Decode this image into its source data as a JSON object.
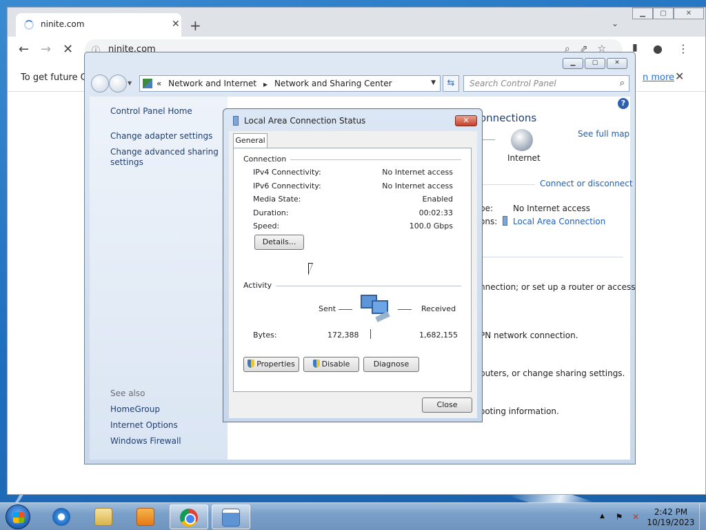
{
  "browser": {
    "tab_title": "ninite.com",
    "url": "ninite.com",
    "infobar_text": "To get future Go",
    "infobar_link": "n more"
  },
  "control_panel": {
    "breadcrumb_1": "Network and Internet",
    "breadcrumb_2": "Network and Sharing Center",
    "search_placeholder": "Search Control Panel",
    "left_links": {
      "home": "Control Panel Home",
      "adapter": "Change adapter settings",
      "advanced_1": "Change advanced sharing",
      "advanced_2": "settings"
    },
    "see_also": "See also",
    "see_also_links": [
      "HomeGroup",
      "Internet Options",
      "Windows Firewall"
    ],
    "right": {
      "heading_fragment": "onnections",
      "see_full_map": "See full map",
      "internet_label": "Internet",
      "connect_disconnect": "Connect or disconnect",
      "access_type_fragment": "pe:",
      "access_type_value": "No Internet access",
      "connections_fragment": "ons:",
      "connection_link": "Local Area Connection",
      "task_1": "nnection; or set up a router or access",
      "task_2": "PN network connection.",
      "task_3": "puters, or change sharing settings.",
      "task_4": "ooting information."
    }
  },
  "dialog": {
    "title": "Local Area Connection Status",
    "tab": "General",
    "connection_group": "Connection",
    "rows": [
      {
        "label": "IPv4 Connectivity:",
        "value": "No Internet access"
      },
      {
        "label": "IPv6 Connectivity:",
        "value": "No Internet access"
      },
      {
        "label": "Media State:",
        "value": "Enabled"
      },
      {
        "label": "Duration:",
        "value": "00:02:33"
      },
      {
        "label": "Speed:",
        "value": "100.0 Gbps"
      }
    ],
    "details_button": "Details...",
    "activity_group": "Activity",
    "sent_label": "Sent",
    "received_label": "Received",
    "bytes_label": "Bytes:",
    "bytes_sent": "172,388",
    "bytes_received": "1,682,155",
    "properties_button": "Properties",
    "disable_button": "Disable",
    "diagnose_button": "Diagnose",
    "close_button": "Close"
  },
  "taskbar": {
    "time": "2:42 PM",
    "date": "10/19/2023"
  }
}
